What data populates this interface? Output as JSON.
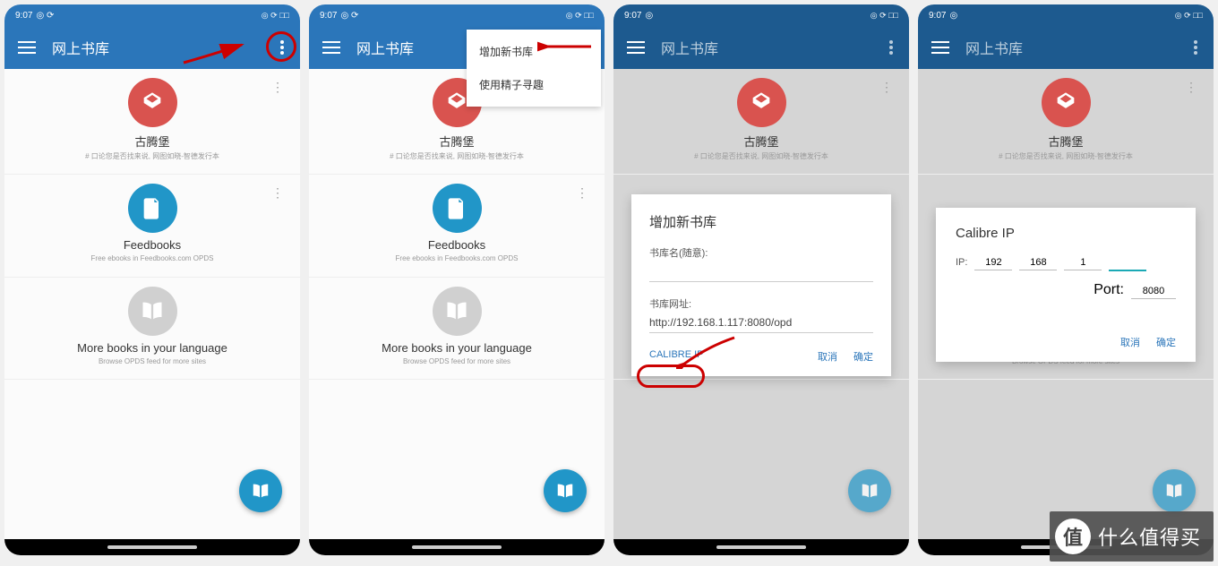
{
  "status": {
    "time": "9:07",
    "icons": "◎ ⟳ □□"
  },
  "appbar": {
    "title": "网上书库"
  },
  "popmenu": {
    "item1": "增加新书库",
    "item2": "使用精子寻趣"
  },
  "cards": {
    "gutenberg": {
      "title": "古腾堡",
      "sub": "# 口论您是否找来说, 网图如晓-智德发行本"
    },
    "feedbooks": {
      "title": "Feedbooks",
      "sub": "Free ebooks in Feedbooks.com OPDS"
    },
    "more": {
      "title": "More books in your language",
      "sub": "Browse OPDS feed for more sites"
    }
  },
  "dialog1": {
    "title": "增加新书库",
    "label_name": "书库名(随意):",
    "label_url": "书库网址:",
    "url_value": "http://192.168.1.117:8080/opd",
    "calibre": "CALIBRE IP",
    "cancel": "取消",
    "ok": "确定"
  },
  "dialog2": {
    "title": "Calibre IP",
    "ip_label": "IP:",
    "ip1": "192",
    "ip2": "168",
    "ip3": "1",
    "ip4": "",
    "port_label": "Port:",
    "port_value": "8080",
    "cancel": "取消",
    "ok": "确定"
  },
  "watermark": {
    "icon": "值",
    "text": "什么值得买"
  }
}
